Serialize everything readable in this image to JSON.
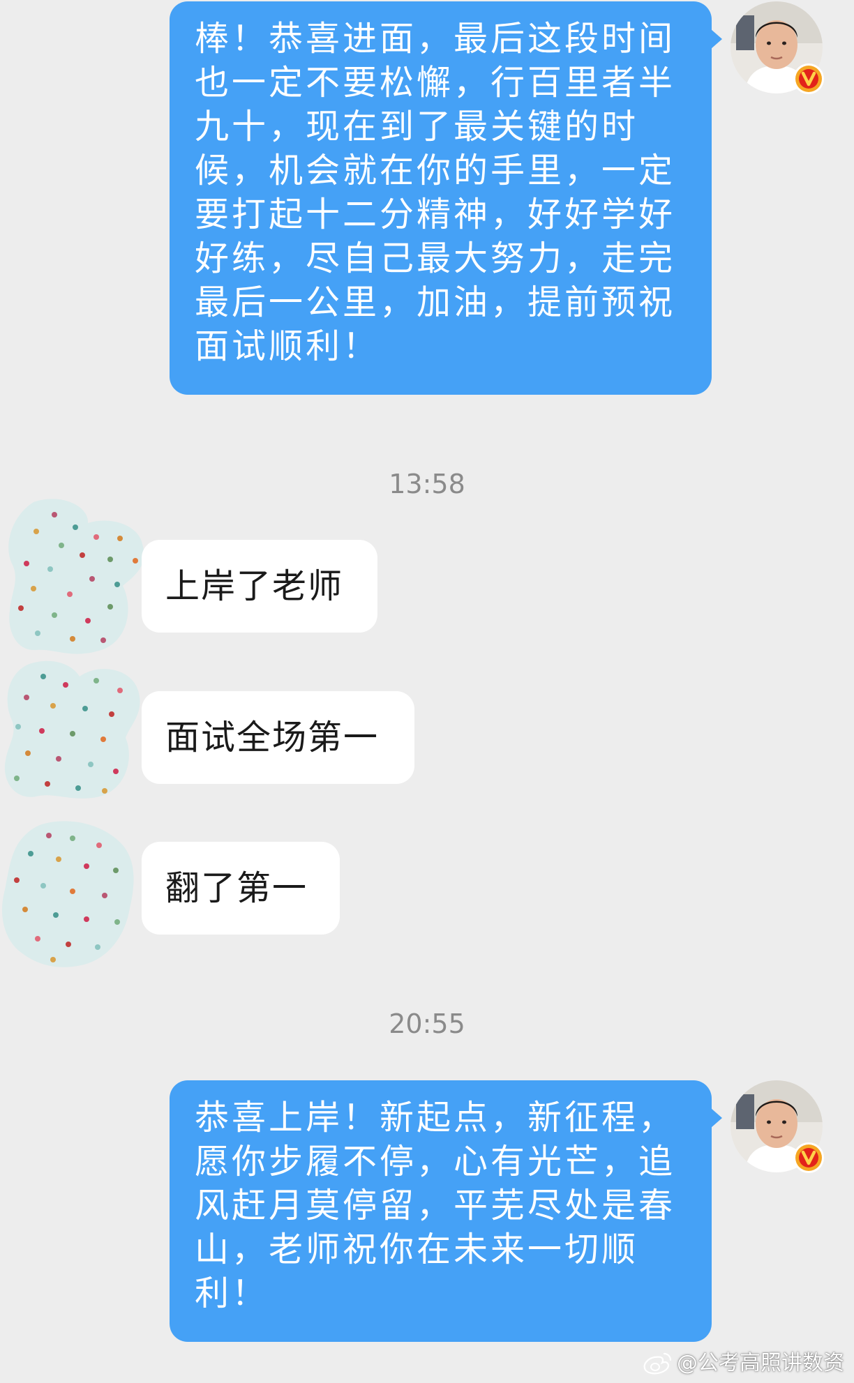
{
  "colors": {
    "background": "#ededed",
    "outgoing_bubble": "#45a1f6",
    "incoming_bubble": "#ffffff",
    "timestamp_text": "#8a8a8a",
    "verified_badge": "#f5a623"
  },
  "messages": [
    {
      "direction": "outgoing",
      "text": "棒！恭喜进面，最后这段时间也一定不要松懈，行百里者半九十，现在到了最关键的时候，机会就在你的手里，一定要打起十二分精神，好好学好好练，尽自己最大努力，走完最后一公里，加油，提前预祝面试顺利！",
      "avatar_icon": "teacher-avatar",
      "badge_icon": "verified-v-badge"
    },
    {
      "type": "timestamp",
      "text": "13:58"
    },
    {
      "direction": "incoming",
      "text": "上岸了老师",
      "avatar_icon": "blurred-avatar"
    },
    {
      "direction": "incoming",
      "text": "面试全场第一",
      "avatar_icon": "blurred-avatar"
    },
    {
      "direction": "incoming",
      "text": "翻了第一",
      "avatar_icon": "blurred-avatar"
    },
    {
      "type": "timestamp",
      "text": "20:55"
    },
    {
      "direction": "outgoing",
      "text": "恭喜上岸！新起点，新征程，愿你步履不停，心有光芒，追风赶月莫停留，平芜尽处是春山，老师祝你在未来一切顺利！",
      "avatar_icon": "teacher-avatar",
      "badge_icon": "verified-v-badge"
    }
  ],
  "watermark": {
    "icon": "weibo-icon",
    "text": "@公考高照讲数资"
  }
}
